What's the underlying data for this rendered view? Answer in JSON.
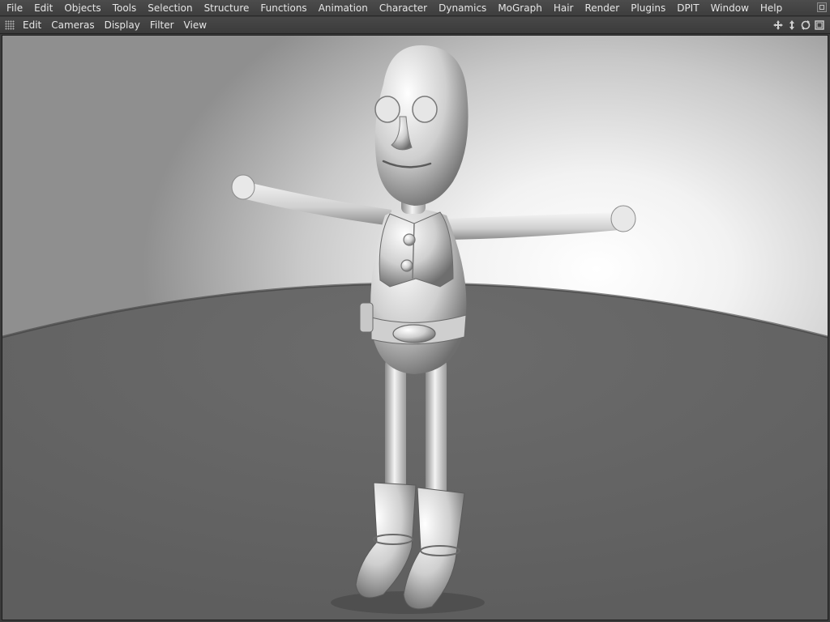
{
  "menubar": {
    "items": [
      "File",
      "Edit",
      "Objects",
      "Tools",
      "Selection",
      "Structure",
      "Functions",
      "Animation",
      "Character",
      "Dynamics",
      "MoGraph",
      "Hair",
      "Render",
      "Plugins",
      "DPIT",
      "Window",
      "Help"
    ]
  },
  "viewbar": {
    "items": [
      "Edit",
      "Cameras",
      "Display",
      "Filter",
      "View"
    ],
    "icons": [
      "move-icon",
      "scale-icon",
      "rotate-icon",
      "maximize-icon"
    ]
  },
  "viewport": {
    "floor_color": "#676767",
    "figure_base_color": "#d9d9d9"
  }
}
